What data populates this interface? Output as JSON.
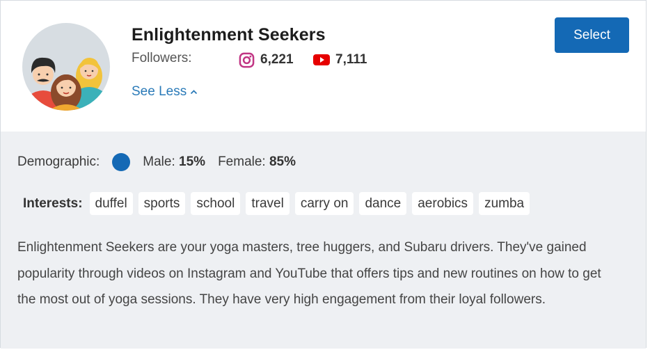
{
  "card": {
    "title": "Enlightenment Seekers",
    "followers_label": "Followers:",
    "instagram": {
      "icon": "instagram-icon",
      "count": "6,221",
      "color": "#c13584"
    },
    "youtube": {
      "icon": "youtube-icon",
      "count": "7,111",
      "color": "#e60000"
    },
    "see_less_label": "See Less",
    "select_label": "Select",
    "accent_color": "#1469b5"
  },
  "demographic": {
    "label": "Demographic:",
    "male_label": "Male:",
    "male_value": "15%",
    "female_label": "Female:",
    "female_value": "85%"
  },
  "interests": {
    "label": "Interests:",
    "tags": [
      "duffel",
      "sports",
      "school",
      "travel",
      "carry on",
      "dance",
      "aerobics",
      "zumba"
    ]
  },
  "description": "Enlightenment Seekers are your yoga masters, tree huggers, and Subaru drivers. They've gained popularity through videos on Instagram and YouTube that offers tips and new routines on how to get the most out of yoga sessions. They have very high engagement from their loyal followers."
}
